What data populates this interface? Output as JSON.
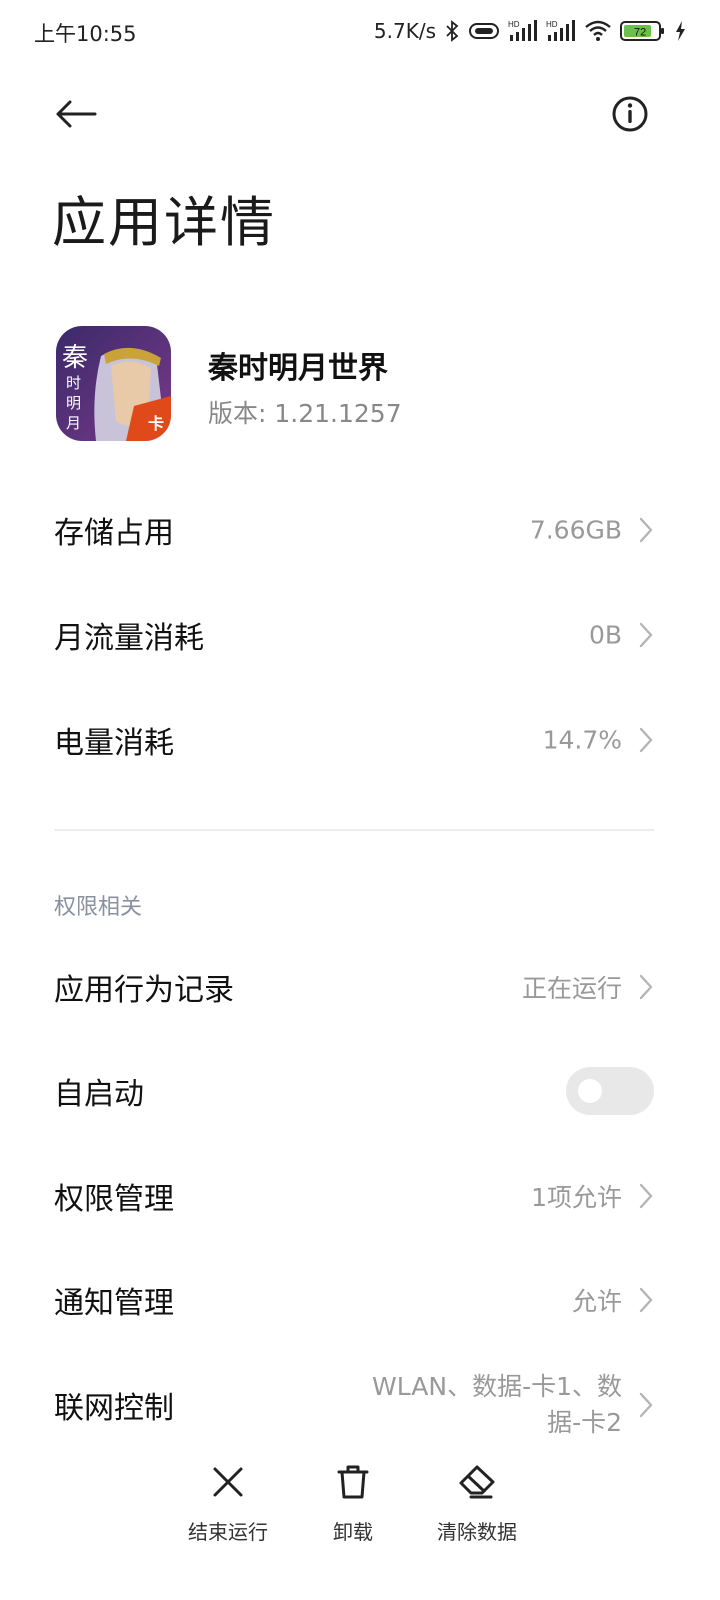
{
  "status_bar": {
    "time": "上午10:55",
    "speed": "5.7K/s",
    "battery": "72",
    "signal_label": "HD",
    "wifi_label": "6"
  },
  "header": {
    "title": "应用详情"
  },
  "app": {
    "name": "秦时明月世界",
    "version": "版本: 1.21.1257",
    "icon_text": "秦时明月",
    "icon_badge": "卡"
  },
  "usage_rows": [
    {
      "label": "存储占用",
      "value": "7.66GB"
    },
    {
      "label": "月流量消耗",
      "value": "0B"
    },
    {
      "label": "电量消耗",
      "value": "14.7%"
    }
  ],
  "permissions_section": {
    "title": "权限相关",
    "rows": [
      {
        "label": "应用行为记录",
        "value": "正在运行"
      },
      {
        "label": "自启动",
        "toggle_on": false
      },
      {
        "label": "权限管理",
        "value": "1项允许"
      },
      {
        "label": "通知管理",
        "value": "允许"
      },
      {
        "label": "联网控制",
        "value_line1": "WLAN、数据-卡1、数",
        "value_line2": "据-卡2"
      }
    ]
  },
  "bottom_actions": [
    {
      "label": "结束运行",
      "icon": "close-icon"
    },
    {
      "label": "卸载",
      "icon": "trash-icon"
    },
    {
      "label": "清除数据",
      "icon": "eraser-icon"
    }
  ]
}
